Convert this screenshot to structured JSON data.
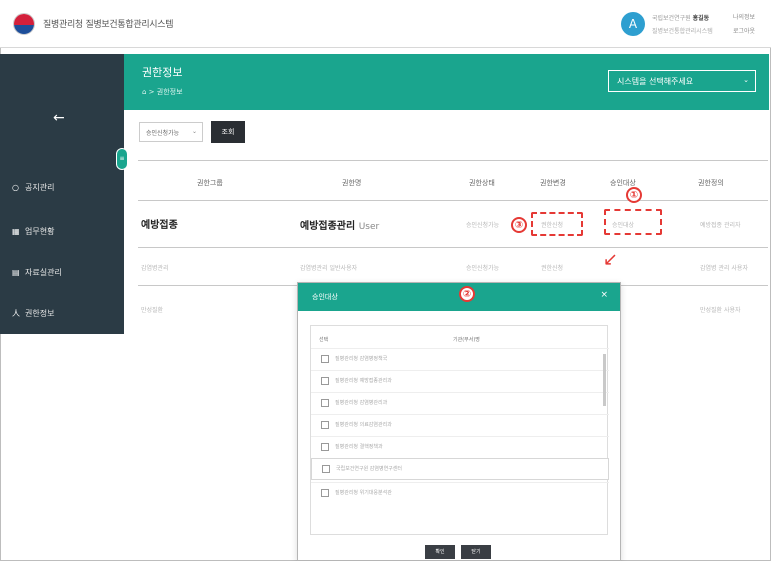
{
  "app": {
    "title": "질병관리청 질병보건통합관리시스템",
    "avatar_letter": "A",
    "user_line1_pre": "국립보건연구원 ",
    "user_name": "홍길동",
    "user_line2": "질병보건통합관리시스템",
    "top_right1": "나의정보",
    "top_right2": "로그아웃"
  },
  "sidebar": {
    "back_icon": "←",
    "toggle_icon": "≡",
    "items": [
      {
        "icon": "○",
        "label": "공지관리"
      },
      {
        "icon": "▦",
        "label": "업무현황"
      },
      {
        "icon": "▤",
        "label": "자료실관리"
      },
      {
        "icon": "人",
        "label": "권한정보"
      }
    ]
  },
  "header": {
    "title": "권한정보",
    "breadcrumb": "⌂ > 권한정보",
    "system_select": "시스템을 선택해주세요",
    "chevron": "⌄"
  },
  "filter": {
    "select_value": "승인신청가능",
    "chevron": "⌄",
    "search_label": "조회"
  },
  "table": {
    "columns": [
      "권한그룹",
      "권한명",
      "권한상태",
      "권한변경",
      "승인대상",
      "권한정의"
    ],
    "rows": [
      {
        "group": "예방접종",
        "name": "예방접종관리",
        "name_suffix": "User",
        "status": "승인신청가능",
        "change": "권한신청",
        "target": "승인대상",
        "def": "예방접종 관리자"
      },
      {
        "group": "감염병관리",
        "name": "감염병관리 일반사용자",
        "name_suffix": "",
        "status": "승인신청가능",
        "change": "권한신청",
        "target": "",
        "def": "감염병 관리 사용자"
      },
      {
        "group": "만성질환",
        "name": "",
        "name_suffix": "",
        "status": "",
        "change": "",
        "target": "",
        "def": "만성질환 사용자"
      }
    ]
  },
  "annotations": {
    "n1": "①",
    "n2": "②",
    "n3": "③",
    "arrow": "↓"
  },
  "modal": {
    "title": "승인대상",
    "close_icon": "×",
    "columns": [
      "선택",
      "기관(부서)명"
    ],
    "items": [
      "질병관리청 감염병정책국",
      "질병관리청 예방접종관리과",
      "질병관리청 감염병관리과",
      "질병관리청 의료감염관리과",
      "질병관리청 결핵정책과",
      "국립보건연구원 감염병연구센터",
      "질병관리청 위기대응분석관"
    ],
    "confirm_label": "확인",
    "cancel_label": "닫기"
  }
}
